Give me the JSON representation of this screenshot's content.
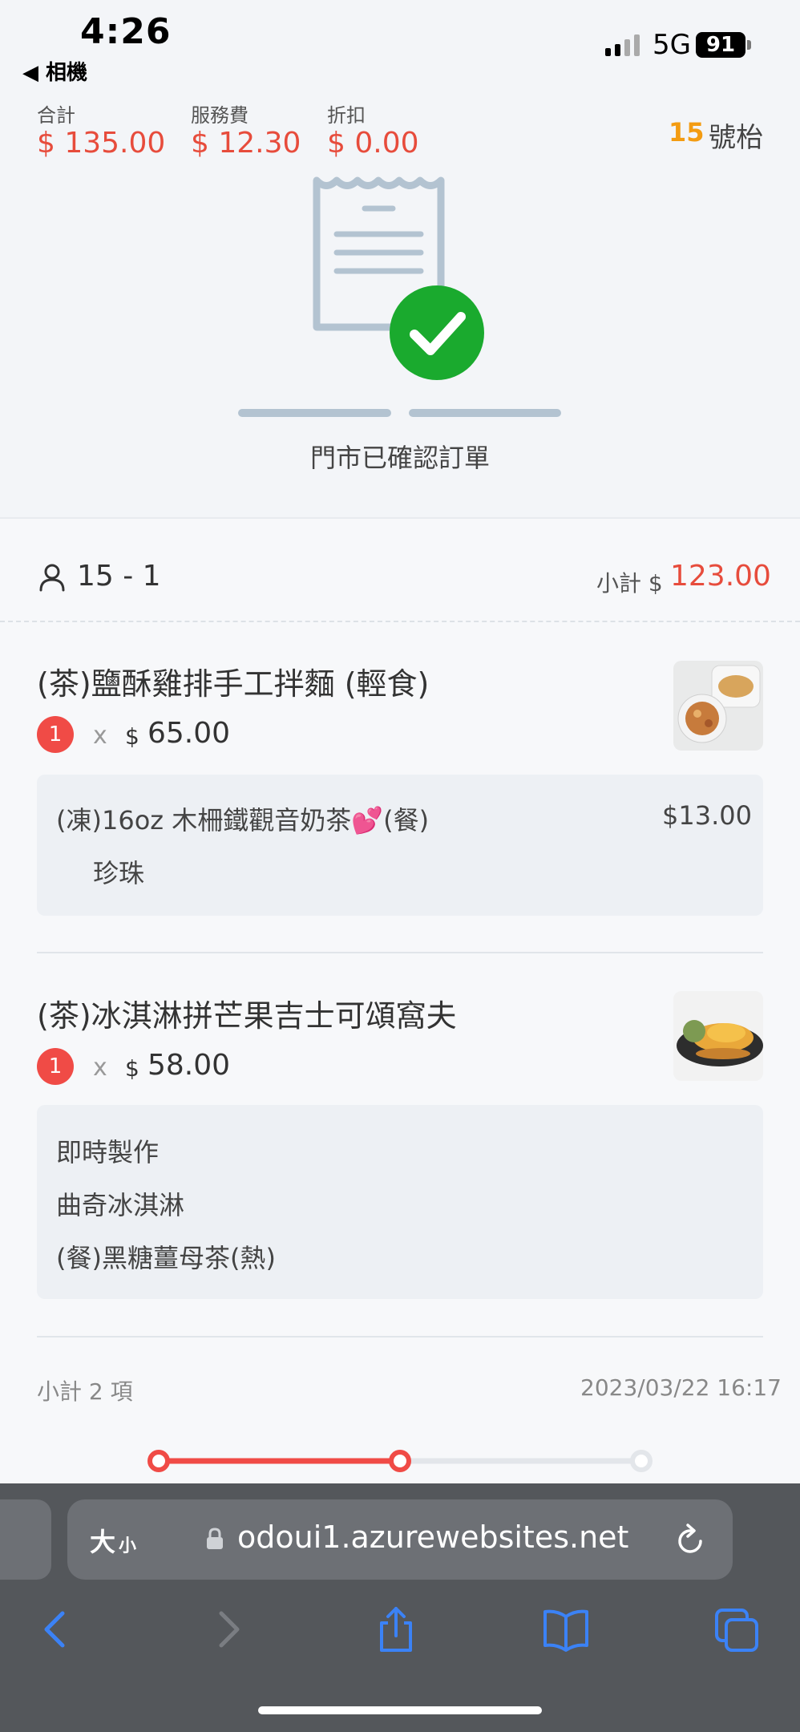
{
  "status_bar": {
    "time": "4:26",
    "back_app": "◀ 相機",
    "network": "5G",
    "battery": "91"
  },
  "summary": {
    "total_label": "合計",
    "total_value": "$ 135.00",
    "service_label": "服務費",
    "service_value": "$ 12.30",
    "discount_label": "折扣",
    "discount_value": "$ 0.00",
    "table_number": "15",
    "table_unit": "號枱"
  },
  "status_message": "門市已確認訂單",
  "order": {
    "guest_label": "15 - 1",
    "subtotal_label": "小計 $",
    "subtotal_value": "123.00",
    "items": [
      {
        "name": "(茶)鹽酥雞排手工拌麵 (輕食)",
        "quantity": "1",
        "times": "x",
        "currency": "$",
        "price": "65.00",
        "options": [
          {
            "label": "(凍)16oz 木柵鐵觀音奶茶💕(餐)",
            "price": "$13.00"
          },
          {
            "label": "珍珠"
          }
        ]
      },
      {
        "name": "(茶)冰淇淋拼芒果吉士可頌窩夫",
        "quantity": "1",
        "times": "x",
        "currency": "$",
        "price": "58.00",
        "options": [
          {
            "label": "即時製作"
          },
          {
            "label": "曲奇冰淇淋"
          },
          {
            "label": "(餐)黑糖薑母茶(熱)"
          }
        ]
      }
    ],
    "footer_count": "小計 2 項",
    "footer_datetime": "2023/03/22 16:17"
  },
  "progress": {
    "current_step": 2,
    "total_steps": 3
  },
  "browser": {
    "text_size_big": "大",
    "text_size_small": "小",
    "url": "odoui1.azurewebsites.net"
  },
  "colors": {
    "accent": "#e74c3c",
    "table_number": "#f39c12",
    "success": "#1aaa2e",
    "link_blue": "#3b82f6"
  },
  "icons": [
    "signal-icon",
    "receipt-icon",
    "check-icon",
    "person-icon",
    "lock-icon",
    "reload-icon",
    "back-icon",
    "forward-icon",
    "share-icon",
    "bookmarks-icon",
    "tabs-icon"
  ]
}
